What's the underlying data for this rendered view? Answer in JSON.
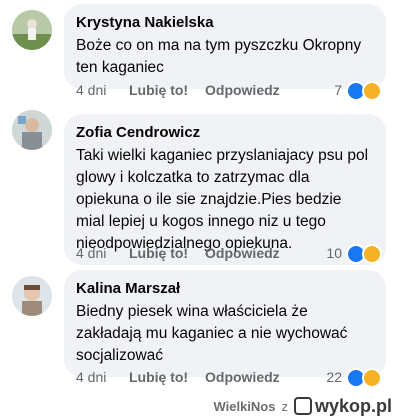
{
  "comments": [
    {
      "author": "Krystyna Nakielska",
      "text": "Boże co on ma na tym pyszczku Okropny ten kaganiec",
      "time": "4 dni",
      "like_label": "Lubię to!",
      "reply_label": "Odpowiedz",
      "reaction_count": "7",
      "reactions": [
        "like-icon",
        "haha-icon"
      ]
    },
    {
      "author": "Zofia Cendrowicz",
      "text": "Taki wielki kaganiec przyslaniajacy psu pol glowy i kolczatka to zatrzymac dla opiekuna o ile sie znajdzie.Pies bedzie mial lepiej u kogos innego niz u tego nieodpowiedzialnego opiekuna.",
      "time": "4 dni",
      "like_label": "Lubię to!",
      "reply_label": "Odpowiedz",
      "reaction_count": "10",
      "reactions": [
        "like-icon",
        "haha-icon"
      ]
    },
    {
      "author": "Kalina Marszał",
      "text": "Biedny piesek wina właściciela że zakładają mu kaganiec a nie wychować socjalizować",
      "time": "4 dni",
      "like_label": "Lubię to!",
      "reply_label": "Odpowiedz",
      "reaction_count": "22",
      "reactions": [
        "like-icon",
        "haha-icon"
      ]
    }
  ],
  "footer": {
    "uploader": "WielkiNos",
    "connector": "z",
    "brand": "wykop.pl"
  },
  "colors": {
    "bubble": "#f0f2f5",
    "meta": "#65676b",
    "like": "#1877f2",
    "haha": "#f7b125"
  }
}
